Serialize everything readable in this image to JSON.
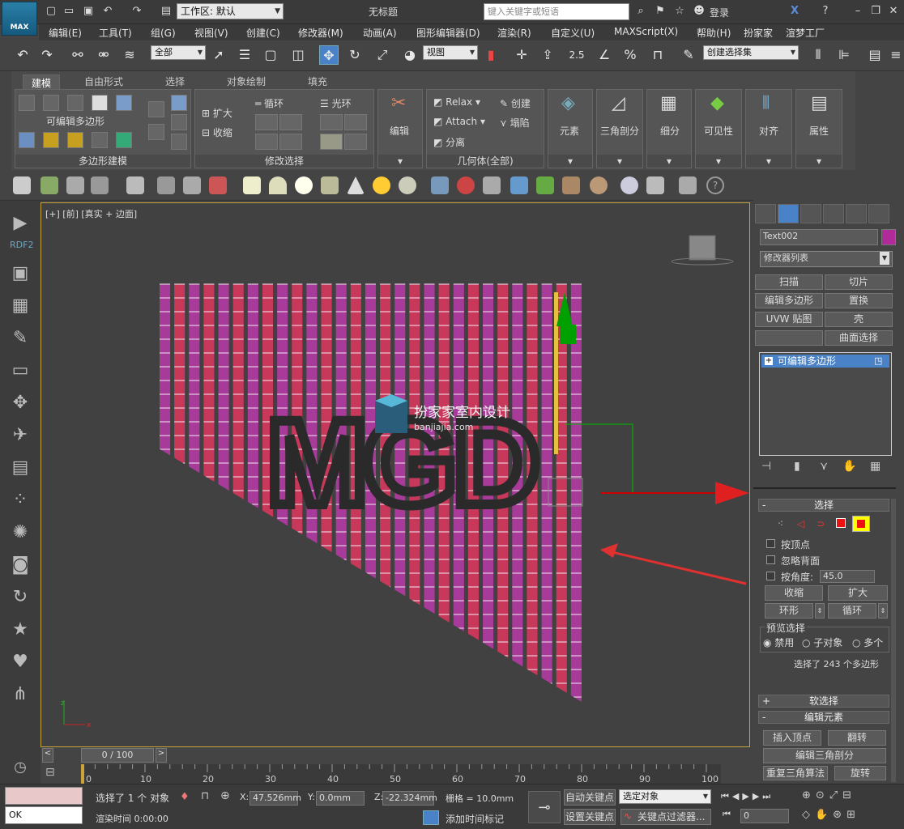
{
  "app": {
    "title": "无标题",
    "logo": "MAX",
    "workspace": "工作区: 默认",
    "search_placeholder": "键入关键字或短语",
    "login": "登录"
  },
  "menu": [
    "编辑(E)",
    "工具(T)",
    "组(G)",
    "视图(V)",
    "创建(C)",
    "修改器(M)",
    "动画(A)",
    "图形编辑器(D)",
    "渲染(R)",
    "自定义(U)",
    "MAXScript(X)",
    "帮助(H)",
    "扮家家",
    "渲梦工厂"
  ],
  "toolbar": {
    "filter": "全部",
    "refcoord": "视图",
    "selset": "创建选择集",
    "snap_num": "2.5",
    "pct": "%"
  },
  "ribbon": {
    "tabs": [
      "建模",
      "自由形式",
      "选择",
      "对象绘制",
      "填充"
    ],
    "poly_label": "可编辑多边形",
    "poly_title": "多边形建模",
    "grow": "扩大",
    "shrink": "收缩",
    "loop": "循环",
    "ring": "光环",
    "modsel_title": "修改选择",
    "edit": "编辑",
    "relax": "Relax",
    "create": "创建",
    "attach": "Attach",
    "collapse": "塌陷",
    "detach": "分离",
    "geo_title": "几何体(全部)",
    "element": "元素",
    "tri": "三角剖分",
    "subdiv": "细分",
    "vis": "可见性",
    "align": "对齐",
    "props": "属性"
  },
  "leftbar": {
    "label": "RDF2"
  },
  "viewport": {
    "label": "[+] [前] [真实 + 边面]",
    "watermark_text": "扮家家室内设计",
    "watermark_url": "banjiajia.com",
    "text_obj": "MGD"
  },
  "cmdpanel": {
    "object_name": "Text002",
    "modlist": "修改器列表",
    "mods": [
      "扫描",
      "切片",
      "编辑多边形",
      "置换",
      "UVW 贴图",
      "壳",
      "",
      "曲面选择"
    ],
    "stack_item": "可编辑多边形",
    "sel_roll": "选择",
    "by_vertex": "按顶点",
    "ignore_back": "忽略背面",
    "by_angle": "按角度:",
    "angle_val": "45.0",
    "shrink": "收缩",
    "grow": "扩大",
    "ring": "环形",
    "loop": "循环",
    "preview": "预览选择",
    "disable": "禁用",
    "subobj": "子对象",
    "multi": "多个",
    "sel_info": "选择了 243 个多边形",
    "soft_roll": "软选择",
    "edit_el_roll": "编辑元素",
    "insert_vertex": "插入顶点",
    "flip": "翻转",
    "edit_tri": "编辑三角剖分",
    "retri": "重复三角算法",
    "turn": "旋转"
  },
  "timeline": {
    "slider": "0 / 100",
    "ticks": [
      "0",
      "10",
      "20",
      "30",
      "40",
      "50",
      "60",
      "70",
      "80",
      "90",
      "100"
    ]
  },
  "status": {
    "maxscript": "OK",
    "selected": "选择了 1 个 对象",
    "render_time": "渲染时间  0:00:00",
    "x_label": "X:",
    "x": "47.526mm",
    "y_label": "Y:",
    "y": "0.0mm",
    "z_label": "Z:",
    "z": "-22.324mm",
    "grid": "栅格 = 10.0mm",
    "add_tag": "添加时间标记",
    "autokey": "自动关键点",
    "selobj": "选定对象",
    "setkey": "设置关键点",
    "keyfilter": "关键点过滤器...",
    "frame": "0"
  }
}
